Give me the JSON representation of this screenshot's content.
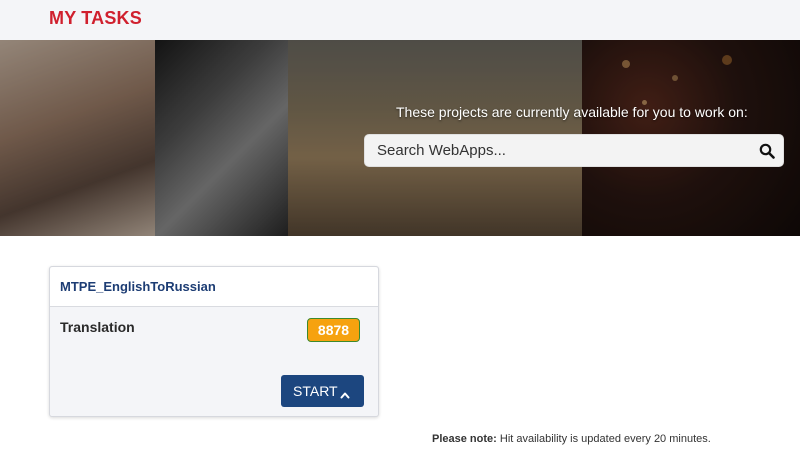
{
  "page": {
    "title": "MY TASKS"
  },
  "hero": {
    "message": "These projects are currently available for you to work on:",
    "search": {
      "placeholder": "Search WebApps...",
      "value": ""
    },
    "search_icon": "search-icon"
  },
  "tasks": [
    {
      "name": "MTPE_EnglishToRussian",
      "type": "Translation",
      "count": "8878",
      "action_label": "START",
      "action_icon": "chevron-up-icon"
    }
  ],
  "note": {
    "label": "Please note:",
    "text": " Hit availability is updated every 20 minutes."
  },
  "colors": {
    "title_red": "#d0202e",
    "navy": "#1c467f",
    "badge_orange": "#f6a20f",
    "badge_border": "#3d8a2c"
  }
}
